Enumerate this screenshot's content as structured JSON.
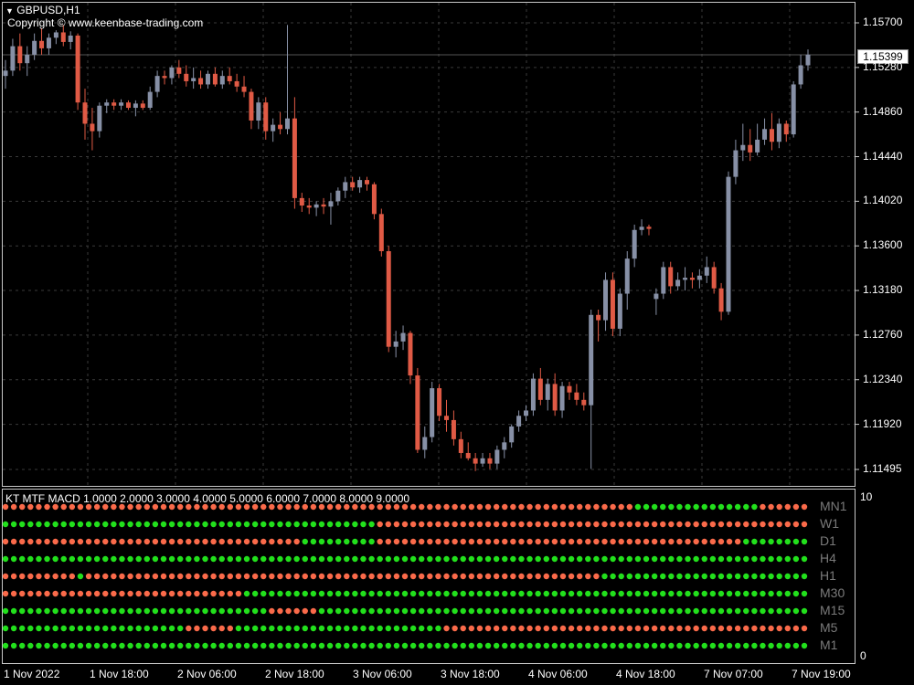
{
  "chart_header": {
    "symbol_label": "GBPUSD,H1",
    "copyright": "Copyright © www.keenbase-trading.com"
  },
  "current_price": "1.15399",
  "price_axis": [
    "1.15700",
    "1.15280",
    "1.14860",
    "1.14440",
    "1.14020",
    "1.13600",
    "1.13180",
    "1.12760",
    "1.12340",
    "1.11920",
    "1.11495"
  ],
  "time_axis": [
    "1 Nov 2022",
    "1 Nov 18:00",
    "2 Nov 06:00",
    "2 Nov 18:00",
    "3 Nov 06:00",
    "3 Nov 18:00",
    "4 Nov 06:00",
    "4 Nov 18:00",
    "7 Nov 07:00",
    "7 Nov 19:00"
  ],
  "indicator": {
    "title": "KT MTF MACD 1.0000 2.0000 3.0000 4.0000 5.0000 6.0000 7.0000 8.0000 9.0000",
    "scale_top": "10",
    "scale_bottom": "0",
    "rows": [
      "MN1",
      "W1",
      "D1",
      "H4",
      "H1",
      "M30",
      "M15",
      "M5",
      "M1"
    ]
  },
  "colors": {
    "bull": "#8790a6",
    "bear": "#e05a45",
    "dot_green": "#22e01c",
    "dot_red": "#fa6a4a",
    "grid": "#3a3a3a"
  },
  "chart_data": {
    "type": "candlestick",
    "symbol": "GBPUSD",
    "timeframe": "H1",
    "ylim": [
      1.1135,
      1.158
    ],
    "current_price": 1.15399,
    "candles": [
      [
        1.152,
        1.1535,
        1.1508,
        1.1525
      ],
      [
        1.1525,
        1.1555,
        1.152,
        1.1548
      ],
      [
        1.1548,
        1.156,
        1.1525,
        1.1532
      ],
      [
        1.1532,
        1.1548,
        1.152,
        1.154
      ],
      [
        1.154,
        1.156,
        1.1535,
        1.1553
      ],
      [
        1.1553,
        1.1565,
        1.154,
        1.1546
      ],
      [
        1.1546,
        1.156,
        1.154,
        1.1556
      ],
      [
        1.1556,
        1.1563,
        1.155,
        1.1561
      ],
      [
        1.1561,
        1.1568,
        1.1548,
        1.1552
      ],
      [
        1.1552,
        1.1562,
        1.1545,
        1.1558
      ],
      [
        1.1558,
        1.156,
        1.1488,
        1.1495
      ],
      [
        1.1495,
        1.1508,
        1.146,
        1.1475
      ],
      [
        1.1475,
        1.149,
        1.145,
        1.1468
      ],
      [
        1.1468,
        1.1495,
        1.1462,
        1.1492
      ],
      [
        1.1492,
        1.1498,
        1.1485,
        1.1495
      ],
      [
        1.1495,
        1.1498,
        1.1488,
        1.1492
      ],
      [
        1.1492,
        1.1498,
        1.1488,
        1.1495
      ],
      [
        1.1495,
        1.1497,
        1.1488,
        1.149
      ],
      [
        1.149,
        1.1497,
        1.1482,
        1.1494
      ],
      [
        1.1494,
        1.1497,
        1.1488,
        1.149
      ],
      [
        1.149,
        1.151,
        1.1488,
        1.1505
      ],
      [
        1.1505,
        1.1525,
        1.15,
        1.152
      ],
      [
        1.152,
        1.1525,
        1.1512,
        1.1518
      ],
      [
        1.1518,
        1.153,
        1.1512,
        1.1528
      ],
      [
        1.1528,
        1.1535,
        1.1518,
        1.1522
      ],
      [
        1.1522,
        1.153,
        1.151,
        1.1515
      ],
      [
        1.1515,
        1.1528,
        1.1508,
        1.1518
      ],
      [
        1.1518,
        1.1525,
        1.1508,
        1.1512
      ],
      [
        1.1512,
        1.1525,
        1.1508,
        1.1522
      ],
      [
        1.1522,
        1.1528,
        1.151,
        1.1512
      ],
      [
        1.1512,
        1.1525,
        1.1508,
        1.152
      ],
      [
        1.152,
        1.1528,
        1.1512,
        1.1515
      ],
      [
        1.1515,
        1.1522,
        1.1505,
        1.151
      ],
      [
        1.151,
        1.152,
        1.15,
        1.1505
      ],
      [
        1.1505,
        1.1508,
        1.147,
        1.1478
      ],
      [
        1.1478,
        1.15,
        1.147,
        1.1495
      ],
      [
        1.1495,
        1.15,
        1.146,
        1.1468
      ],
      [
        1.1468,
        1.148,
        1.1458,
        1.1474
      ],
      [
        1.1474,
        1.1486,
        1.1465,
        1.147
      ],
      [
        1.147,
        1.1568,
        1.1465,
        1.148
      ],
      [
        1.148,
        1.15,
        1.1395,
        1.1405
      ],
      [
        1.1405,
        1.141,
        1.1392,
        1.1398
      ],
      [
        1.1398,
        1.1405,
        1.139,
        1.1396
      ],
      [
        1.1396,
        1.1402,
        1.1388,
        1.1399
      ],
      [
        1.1399,
        1.1405,
        1.139,
        1.1397
      ],
      [
        1.1397,
        1.141,
        1.138,
        1.1402
      ],
      [
        1.1402,
        1.1415,
        1.1398,
        1.1412
      ],
      [
        1.1412,
        1.1425,
        1.1405,
        1.142
      ],
      [
        1.142,
        1.1425,
        1.1412,
        1.1415
      ],
      [
        1.1415,
        1.1425,
        1.141,
        1.1422
      ],
      [
        1.1422,
        1.1425,
        1.1412,
        1.1418
      ],
      [
        1.1418,
        1.142,
        1.1385,
        1.139
      ],
      [
        1.139,
        1.1395,
        1.135,
        1.1355
      ],
      [
        1.1355,
        1.136,
        1.126,
        1.1265
      ],
      [
        1.1265,
        1.128,
        1.1255,
        1.127
      ],
      [
        1.127,
        1.1285,
        1.1262,
        1.1278
      ],
      [
        1.1278,
        1.128,
        1.123,
        1.1238
      ],
      [
        1.1238,
        1.1245,
        1.1165,
        1.1168
      ],
      [
        1.1168,
        1.119,
        1.116,
        1.118
      ],
      [
        1.118,
        1.1232,
        1.1175,
        1.1226
      ],
      [
        1.1226,
        1.123,
        1.1195,
        1.12
      ],
      [
        1.12,
        1.1215,
        1.1185,
        1.1196
      ],
      [
        1.1196,
        1.1205,
        1.1172,
        1.1178
      ],
      [
        1.1178,
        1.1185,
        1.116,
        1.1165
      ],
      [
        1.1165,
        1.1175,
        1.1158,
        1.116
      ],
      [
        1.116,
        1.1165,
        1.1148,
        1.1155
      ],
      [
        1.1155,
        1.1165,
        1.1152,
        1.116
      ],
      [
        1.116,
        1.1165,
        1.115,
        1.1155
      ],
      [
        1.1155,
        1.1172,
        1.115,
        1.1168
      ],
      [
        1.1168,
        1.118,
        1.116,
        1.1175
      ],
      [
        1.1175,
        1.1192,
        1.117,
        1.119
      ],
      [
        1.119,
        1.1205,
        1.1185,
        1.12
      ],
      [
        1.12,
        1.121,
        1.1195,
        1.1205
      ],
      [
        1.1205,
        1.124,
        1.12,
        1.1235
      ],
      [
        1.1235,
        1.1245,
        1.121,
        1.1215
      ],
      [
        1.1215,
        1.1235,
        1.1205,
        1.123
      ],
      [
        1.123,
        1.124,
        1.12,
        1.1205
      ],
      [
        1.1205,
        1.1232,
        1.1198,
        1.1228
      ],
      [
        1.1228,
        1.1232,
        1.1215,
        1.1222
      ],
      [
        1.1222,
        1.123,
        1.121,
        1.1215
      ],
      [
        1.1215,
        1.1222,
        1.1205,
        1.121
      ],
      [
        1.121,
        1.13,
        1.115,
        1.1295
      ],
      [
        1.1295,
        1.13,
        1.127,
        1.129
      ],
      [
        1.129,
        1.1335,
        1.128,
        1.1328
      ],
      [
        1.1328,
        1.1335,
        1.1275,
        1.1282
      ],
      [
        1.1282,
        1.132,
        1.1275,
        1.1315
      ],
      [
        1.1315,
        1.1355,
        1.13,
        1.1348
      ],
      [
        1.1348,
        1.138,
        1.134,
        1.1375
      ],
      [
        1.1375,
        1.1385,
        1.137,
        1.1378
      ],
      [
        1.1378,
        1.138,
        1.137,
        1.1376
      ],
      [
        1.131,
        1.132,
        1.1295,
        1.1315
      ],
      [
        1.1315,
        1.1345,
        1.131,
        1.134
      ],
      [
        1.134,
        1.1345,
        1.1315,
        1.1322
      ],
      [
        1.1322,
        1.1335,
        1.1318,
        1.1328
      ],
      [
        1.1328,
        1.134,
        1.1318,
        1.133
      ],
      [
        1.133,
        1.1335,
        1.132,
        1.1328
      ],
      [
        1.1328,
        1.1338,
        1.132,
        1.1332
      ],
      [
        1.1332,
        1.135,
        1.1325,
        1.134
      ],
      [
        1.134,
        1.1345,
        1.1315,
        1.132
      ],
      [
        1.132,
        1.1325,
        1.129,
        1.1298
      ],
      [
        1.1298,
        1.143,
        1.1295,
        1.1425
      ],
      [
        1.1425,
        1.146,
        1.1418,
        1.145
      ],
      [
        1.145,
        1.1475,
        1.144,
        1.1455
      ],
      [
        1.1455,
        1.147,
        1.144,
        1.1448
      ],
      [
        1.1448,
        1.1475,
        1.1445,
        1.146
      ],
      [
        1.146,
        1.148,
        1.1455,
        1.147
      ],
      [
        1.147,
        1.1485,
        1.145,
        1.1458
      ],
      [
        1.1458,
        1.148,
        1.1452,
        1.1475
      ],
      [
        1.1475,
        1.1478,
        1.1458,
        1.1465
      ],
      [
        1.1465,
        1.1515,
        1.1462,
        1.1512
      ],
      [
        1.1512,
        1.154,
        1.1508,
        1.153
      ],
      [
        1.153,
        1.1545,
        1.1525,
        1.154
      ]
    ]
  }
}
